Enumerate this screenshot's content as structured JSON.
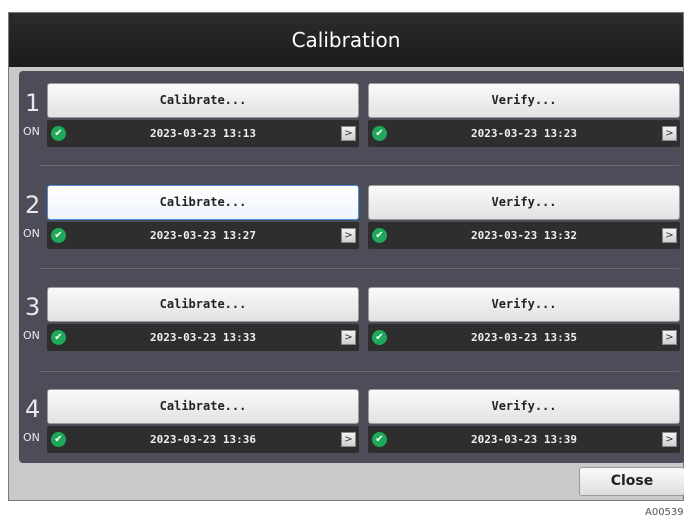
{
  "window": {
    "title": "Calibration"
  },
  "rows": [
    {
      "number": "1",
      "status": "ON",
      "calibrate": {
        "label": "Calibrate...",
        "timestamp": "2023-03-23 13:13"
      },
      "verify": {
        "label": "Verify...",
        "timestamp": "2023-03-23 13:23"
      }
    },
    {
      "number": "2",
      "status": "ON",
      "calibrate": {
        "label": "Calibrate...",
        "timestamp": "2023-03-23 13:27"
      },
      "verify": {
        "label": "Verify...",
        "timestamp": "2023-03-23 13:32"
      }
    },
    {
      "number": "3",
      "status": "ON",
      "calibrate": {
        "label": "Calibrate...",
        "timestamp": "2023-03-23 13:33"
      },
      "verify": {
        "label": "Verify...",
        "timestamp": "2023-03-23 13:35"
      }
    },
    {
      "number": "4",
      "status": "ON",
      "calibrate": {
        "label": "Calibrate...",
        "timestamp": "2023-03-23 13:36"
      },
      "verify": {
        "label": "Verify...",
        "timestamp": "2023-03-23 13:39"
      }
    }
  ],
  "icons": {
    "status_ok": "check-circle-icon",
    "next": "arrow-right-icon"
  },
  "glyphs": {
    "check": "✔",
    "arrow": ">"
  },
  "selected": "rows.1.calibrate",
  "colors": {
    "title_bg": "#1f1f1f",
    "panel_bg": "#4d4d59",
    "ok_green": "#1ea85a",
    "selected_border": "#4a8fd8"
  },
  "footer": {
    "close_label": "Close"
  },
  "figure_id": "A005399"
}
